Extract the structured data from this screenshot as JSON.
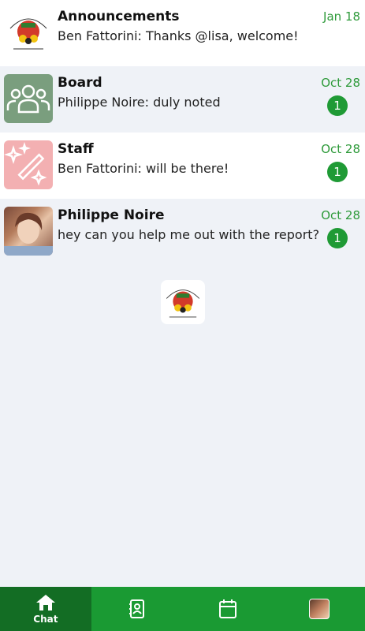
{
  "chats": [
    {
      "title": "Announcements",
      "preview": "Ben Fattorini: Thanks @lisa, welcome!",
      "date": "Jan 18",
      "unread": "",
      "avatar": "logo-icon"
    },
    {
      "title": "Board",
      "preview": "Philippe Noire: duly noted",
      "date": "Oct 28",
      "unread": "1",
      "avatar": "group-icon"
    },
    {
      "title": "Staff",
      "preview": "Ben Fattorini: will be there!",
      "date": "Oct 28",
      "unread": "1",
      "avatar": "magic-wand-icon"
    },
    {
      "title": "Philippe Noire",
      "preview": "hey can you help me out with the report?",
      "date": "Oct 28",
      "unread": "1",
      "avatar": "user-photo"
    }
  ],
  "tabs": [
    {
      "label": "Chat",
      "icon": "home-icon",
      "active": true
    },
    {
      "label": "",
      "icon": "contacts-icon",
      "active": false
    },
    {
      "label": "",
      "icon": "calendar-icon",
      "active": false
    },
    {
      "label": "",
      "icon": "profile-avatar",
      "active": false
    }
  ],
  "colors": {
    "accent": "#1a9a33",
    "accent_dark": "#136d24",
    "date": "#2e9a3a",
    "board_avatar": "#7a9e7e",
    "staff_avatar": "#f3b0b2"
  }
}
